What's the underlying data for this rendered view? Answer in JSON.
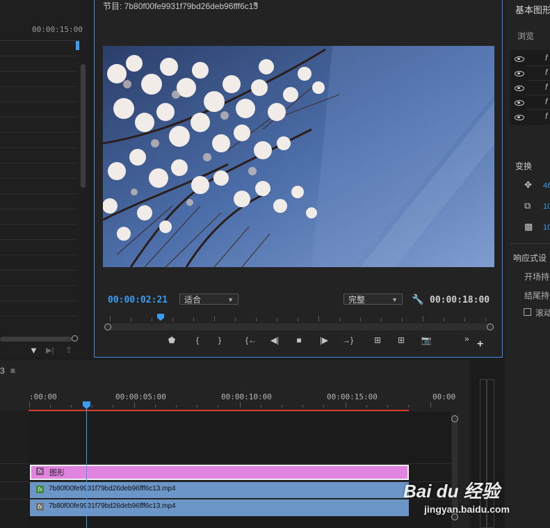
{
  "source_panel": {
    "timecode": "00:00:15:00"
  },
  "program_monitor": {
    "title": "节目: 7b80f00fe9931f79bd26deb96fff6c13",
    "menu_glyph": "≡",
    "current_time": "00:00:02:21",
    "zoom_value": "适合",
    "quality_value": "完整",
    "duration": "00:00:18:00",
    "playhead_fraction": 0.15
  },
  "essential_graphics": {
    "title": "基本图形",
    "browse_label": "浏览",
    "layers": [
      "f",
      "f",
      "f",
      "f",
      "f"
    ],
    "transform_label": "变换",
    "transform_values": [
      "46",
      "10",
      "10"
    ],
    "responsive_label": "响应式设",
    "intro_label": "开场持",
    "outro_label": "结尾持",
    "scroll_label": "滚动"
  },
  "timeline": {
    "tab_number": "3",
    "menu_glyph": "≡",
    "ruler_labels": [
      ":00:00",
      "00:00:05:00",
      "00:00:10:00",
      "00:00:15:00",
      "00:00"
    ],
    "playhead_fraction": 0.15,
    "clips": {
      "graphic": {
        "label": "图形",
        "color": "#e084e0"
      },
      "video": {
        "label": "7b80f00fe9931f79bd26deb96fff6c13.mp4",
        "color": "#6c95c8"
      },
      "audio": {
        "label": "7b80f00fe9931f79bd26deb96fff6c13.mp4",
        "color": "#6c95c8"
      }
    }
  },
  "watermark": {
    "brand": "Bai du 经验",
    "url": "jingyan.baidu.com"
  },
  "colors": {
    "accent": "#3a9df2",
    "work_area": "#d93a2b",
    "panel_border": "#3a8ee6"
  }
}
